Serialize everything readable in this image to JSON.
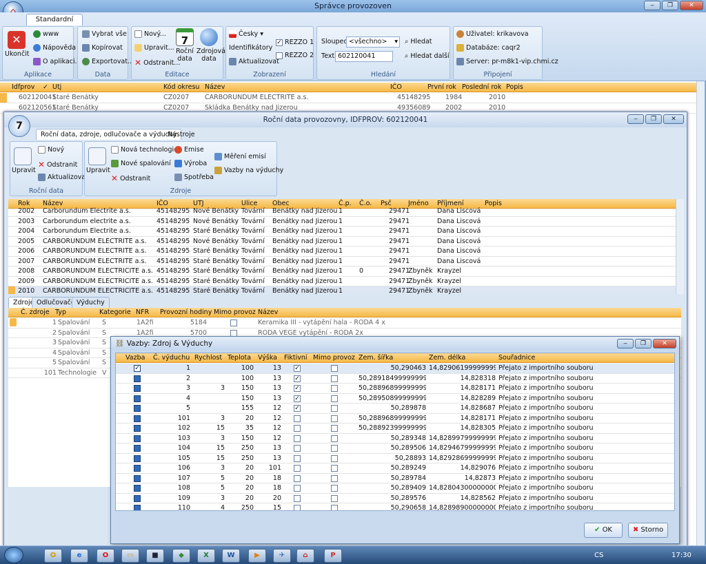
{
  "app": {
    "title": "Správce provozoven"
  },
  "ribbon": {
    "tab": "Standardní menu",
    "groups": {
      "aplikace": "Aplikace",
      "data": "Data",
      "editace": "Editace",
      "zobrazeni": "Zobrazení",
      "hledani": "Hledání",
      "pripojeni": "Připojení"
    },
    "ukoncit": "Ukončit",
    "www": "www",
    "napoveda": "Nápověda",
    "oaplikaci": "O aplikaci...",
    "vybrat_vse": "Vybrat vše",
    "kopirovat": "Kopírovat",
    "exportovat": "Exportovat...",
    "novy": "Nový...",
    "upravit": "Upravit...",
    "odstranit": "Odstranit...",
    "rocni_data": "Roční data",
    "zdrojova_data": "Zdrojová data",
    "cesky": "Česky",
    "identifikatory": "Identifikátory",
    "aktualizovat": "Aktualizovat",
    "rezzo1": "REZZO 1",
    "rezzo2": "REZZO 2",
    "sloupec_label": "Sloupec:",
    "sloupec_value": "<všechno>",
    "text_label": "Text:",
    "text_value": "602120041",
    "hledat": "Hledat",
    "hledat_dalsi": "Hledat další",
    "uzivatel": "Uživatel: krikavova",
    "databaze": "Databáze: caqr2",
    "server": "Server: pr-m8k1-vip.chmi.cz"
  },
  "main_table": {
    "headers": [
      "Idfprov",
      "Utj",
      "Kód okresu",
      "Název",
      "IČO",
      "První rok",
      "Poslední rok",
      "Popis"
    ],
    "rows": [
      [
        "602120041",
        "Staré Benátky",
        "CZ0207",
        "CARBORUNDUM ELECTRITE a.s.",
        "45148295",
        "1984",
        "2010"
      ],
      [
        "602120561",
        "Staré Benátky",
        "CZ0207",
        "Skládka Benátky nad Jizerou",
        "49356089",
        "2002",
        "2010"
      ]
    ]
  },
  "child": {
    "title": "Roční data provozovny, IDFPROV: 602120041",
    "tabs": [
      "Roční data, zdroje, odlučovače a výduchy",
      "Nástroje"
    ],
    "g1": "Roční data",
    "g2": "Zdroje",
    "upravit": "Upravit",
    "novy": "Nový",
    "odstranit": "Odstranit",
    "aktualizovat": "Aktualizovat",
    "upravit2": "Upravit",
    "nova_technologie": "Nová technologie",
    "nove_spalovani": "Nové spalování",
    "odstranit2": "Odstranit",
    "emise": "Emise",
    "vyroba": "Výroba",
    "spotreba": "Spotřeba",
    "mereni": "Měření emisí",
    "vazby": "Vazby na výduchy",
    "year_headers": [
      "Rok",
      "Název",
      "IČO",
      "UTJ",
      "Ulice",
      "Obec",
      "Č.p.",
      "Č.o.",
      "Psč",
      "Jméno",
      "Příjmení",
      "Popis"
    ],
    "years": [
      [
        "2002",
        "Carborundum Electrite a.s.",
        "45148295",
        "Nové Benátky",
        "Tovární",
        "Benátky nad Jizerou",
        "1",
        "",
        "29471",
        "",
        "Dana Liscová"
      ],
      [
        "2003",
        "Carborundum electrite a.s.",
        "45148295",
        "Nové Benátky",
        "Tovární",
        "Benátky nad Jizerou",
        "1",
        "",
        "29471",
        "",
        "Dana Liscová"
      ],
      [
        "2004",
        "Carborundum Electrite a.s.",
        "45148295",
        "Staré Benátky",
        "Tovární",
        "Benátky nad Jizerou",
        "1",
        "",
        "29471",
        "",
        "Dana Liscová"
      ],
      [
        "2005",
        "CARBORUNDUM ELECTRITE a.s.",
        "45148295",
        "Nové Benátky",
        "Tovární",
        "Benátky nad Jizerou",
        "1",
        "",
        "29471",
        "",
        "Dana Liscová"
      ],
      [
        "2006",
        "CARBORUNDUM ELECTRITE a.s.",
        "45148295",
        "Staré Benátky",
        "Tovární",
        "Benátky nad Jizerou",
        "1",
        "",
        "29471",
        "",
        "Dana Liscová"
      ],
      [
        "2007",
        "CARBORUNDUM ELECTRITE a.s.",
        "45148295",
        "Staré Benátky",
        "Tovární",
        "Benátky nad Jizerou",
        "1",
        "",
        "29471",
        "",
        "Dana Liscová"
      ],
      [
        "2008",
        "CARBORUNDUM ELECTRICITE a.s.",
        "45148295",
        "Staré Benátky",
        "Tovární",
        "Benátky nad Jizerou",
        "1",
        "0",
        "29471",
        "Zbyněk",
        "Krayzel"
      ],
      [
        "2009",
        "CARBORUNDUM ELECTRICITE a.s.",
        "45148295",
        "Staré Benátky",
        "Tovární",
        "Benátky nad Jizerou",
        "1",
        "",
        "29471",
        "Zbyněk",
        "Krayzel"
      ],
      [
        "2010",
        "CARBORUNDUM ELECTRICITE a.s.",
        "45148295",
        "Staré Benátky",
        "Tovární",
        "Benátky nad Jizerou",
        "1",
        "",
        "29471",
        "Zbyněk",
        "Krayzel"
      ]
    ],
    "subtabs": [
      "Zdroje",
      "Odlučovače",
      "Výduchy"
    ],
    "src_headers": [
      "Č. zdroje",
      "Typ",
      "Kategorie",
      "NFR",
      "Provozní hodiny",
      "Mimo provoz",
      "Název"
    ],
    "sources": [
      [
        "1",
        "Spalování",
        "S",
        "1A2fi",
        "5184",
        "Keramika III - vytápění hala - RODA 4 x"
      ],
      [
        "2",
        "Spalování",
        "S",
        "1A2fi",
        "5700",
        "RODA VEGE vytápění - RODA 2x"
      ],
      [
        "3",
        "Spalování",
        "S",
        "",
        "",
        ""
      ],
      [
        "4",
        "Spalování",
        "S",
        "",
        "",
        ""
      ],
      [
        "5",
        "Spalování",
        "S",
        "",
        "",
        ""
      ],
      [
        "101",
        "Technologie",
        "V",
        "",
        "",
        ""
      ]
    ]
  },
  "dialog": {
    "title": "Vazby: Zdroj & Výduchy",
    "headers": [
      "Vazba",
      "Č. výduchu",
      "Rychlost",
      "Teplota",
      "Výška",
      "Fiktivní",
      "Mimo provoz",
      "Zem. šířka",
      "Zem. délka",
      "Souřadnice"
    ],
    "rows": [
      [
        "1",
        "",
        "100",
        "13",
        "1",
        "50,290463",
        "14,8290619999999999",
        "Přejato z importního souboru"
      ],
      [
        "2",
        "",
        "100",
        "13",
        "1",
        "50,289184999999996",
        "14,828318",
        "Přejato z importního souboru"
      ],
      [
        "3",
        "3",
        "150",
        "13",
        "1",
        "50,288968999999994",
        "14,828171",
        "Přejato z importního souboru"
      ],
      [
        "4",
        "",
        "150",
        "13",
        "1",
        "50,289508999999995",
        "14,828289",
        "Přejato z importního souboru"
      ],
      [
        "5",
        "",
        "155",
        "12",
        "1",
        "50,289878",
        "14,828687",
        "Přejato z importního souboru"
      ],
      [
        "101",
        "3",
        "20",
        "12",
        "0",
        "50,288968999999994",
        "14,828171",
        "Přejato z importního souboru"
      ],
      [
        "102",
        "15",
        "35",
        "12",
        "0",
        "50,288923999999994",
        "14,828305",
        "Přejato z importního souboru"
      ],
      [
        "103",
        "3",
        "150",
        "12",
        "0",
        "50,289348",
        "14,828997999999999",
        "Přejato z importního souboru"
      ],
      [
        "104",
        "15",
        "250",
        "13",
        "0",
        "50,289506",
        "14,829467999999999",
        "Přejato z importního souboru"
      ],
      [
        "105",
        "15",
        "250",
        "13",
        "0",
        "50,28893",
        "14,829286999999999",
        "Přejato z importního souboru"
      ],
      [
        "106",
        "3",
        "20",
        "101",
        "0",
        "50,289249",
        "14,829076",
        "Přejato z importního souboru"
      ],
      [
        "107",
        "5",
        "20",
        "18",
        "0",
        "50,289784",
        "14,82873",
        "Přejato z importního souboru"
      ],
      [
        "108",
        "5",
        "20",
        "18",
        "0",
        "50,289409",
        "14,828043000000001",
        "Přejato z importního souboru"
      ],
      [
        "109",
        "3",
        "20",
        "20",
        "0",
        "50,289576",
        "14,828562",
        "Přejato z importního souboru"
      ],
      [
        "110",
        "4",
        "250",
        "15",
        "0",
        "50,290658",
        "14,828989000000001",
        "Přejato z importního souboru"
      ]
    ],
    "ok": "OK",
    "storno": "Storno"
  },
  "taskbar": {
    "lang": "CS",
    "time": "17:30"
  }
}
